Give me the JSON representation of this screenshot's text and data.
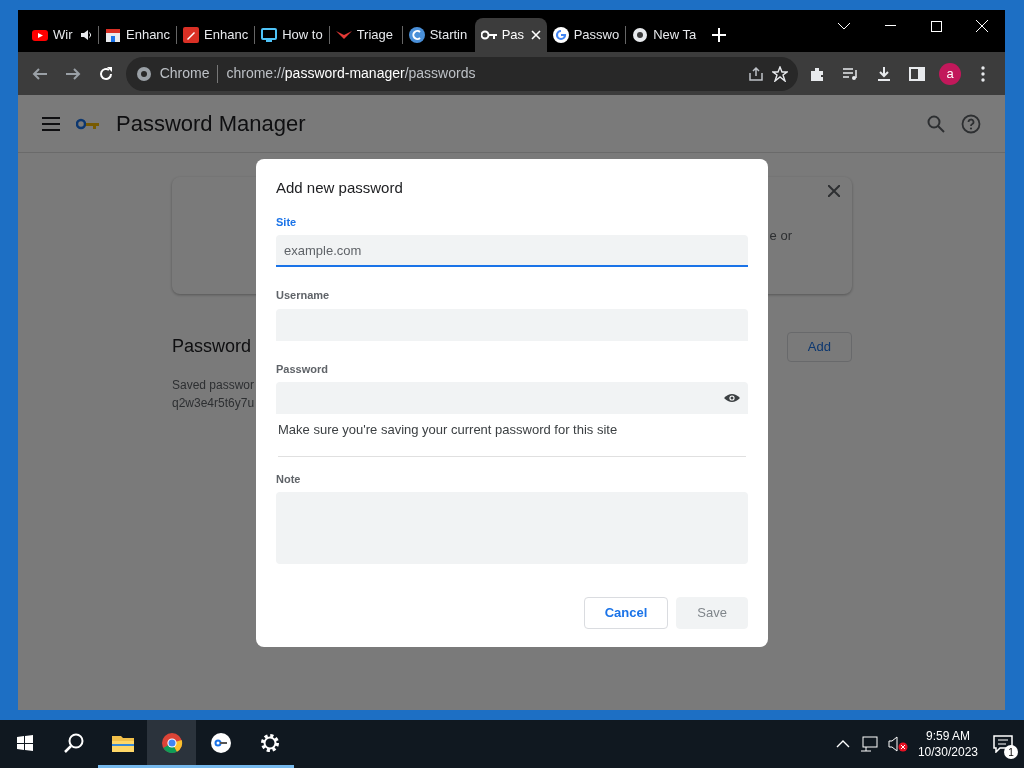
{
  "tabs": [
    {
      "title": "Wir",
      "kind": "youtube",
      "audio": true,
      "selected": false
    },
    {
      "title": "Enhanc",
      "kind": "store",
      "audio": false,
      "selected": false
    },
    {
      "title": "Enhanc",
      "kind": "pen",
      "audio": false,
      "selected": false
    },
    {
      "title": "How to",
      "kind": "monitor",
      "audio": false,
      "selected": false
    },
    {
      "title": "Triage",
      "kind": "wings",
      "audio": false,
      "selected": false
    },
    {
      "title": "Startin",
      "kind": "circle-c",
      "audio": false,
      "selected": false
    },
    {
      "title": "Pas",
      "kind": "key",
      "audio": false,
      "selected": true
    },
    {
      "title": "Passwo",
      "kind": "google",
      "audio": false,
      "selected": false
    },
    {
      "title": "New Ta",
      "kind": "chrome",
      "audio": false,
      "selected": false
    }
  ],
  "address_bar": {
    "chip": "Chrome",
    "scheme": "chrome://",
    "host": "password-manager",
    "path": "/passwords"
  },
  "profile": {
    "initial": "a"
  },
  "app": {
    "title": "Password Manager"
  },
  "background": {
    "banner_text": "e or",
    "heading": "Password",
    "add_button": "Add",
    "saved_text": "Saved passwor",
    "saved_text_2": "q2w3e4r5t6y7u"
  },
  "dialog": {
    "title": "Add new password",
    "fields": [
      {
        "label": "Site",
        "placeholder": "example.com",
        "focused": true,
        "kind": "text"
      },
      {
        "label": "Username",
        "focused": false,
        "kind": "text"
      },
      {
        "label": "Password",
        "focused": false,
        "kind": "password"
      }
    ],
    "hint": "Make sure you're saving your current password for this site",
    "note": {
      "label": "Note"
    },
    "buttons": [
      {
        "label": "Cancel",
        "disabled": false
      },
      {
        "label": "Save",
        "disabled": true
      }
    ]
  },
  "taskbar": {
    "apps": [
      {
        "kind": "explorer",
        "active": false
      },
      {
        "kind": "chrome",
        "active": true
      },
      {
        "kind": "key",
        "active": false
      },
      {
        "kind": "settings",
        "active": false
      }
    ],
    "time": "9:59 AM",
    "date": "10/30/2023",
    "notifications": "1"
  }
}
